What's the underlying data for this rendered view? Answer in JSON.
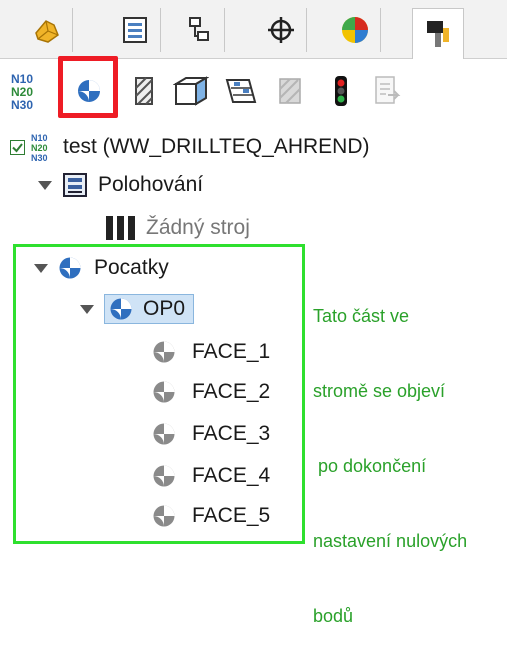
{
  "tabs": [
    {
      "icon": "part-icon"
    },
    {
      "icon": "property-list-icon"
    },
    {
      "icon": "configuration-icon"
    },
    {
      "icon": "crosshair-icon"
    },
    {
      "icon": "appearance-icon"
    },
    {
      "icon": "drillteq-tool-icon"
    }
  ],
  "toolbar": {
    "items": [
      {
        "icon": "nc-program-icon",
        "text": "N10\nN20\nN30"
      },
      {
        "icon": "origin-icon"
      },
      {
        "icon": "hatch-icon"
      },
      {
        "icon": "face-icon"
      },
      {
        "icon": "table-icon"
      },
      {
        "icon": "pattern-icon"
      },
      {
        "icon": "traffic-light-icon"
      },
      {
        "icon": "export-icon"
      }
    ]
  },
  "tree": {
    "root": {
      "label": "test (WW_DRILLTEQ_AHREND)",
      "checked": true
    },
    "positioning": {
      "label": "Polohování"
    },
    "no_machine": {
      "label": "Žádný stroj"
    },
    "origins": {
      "label": "Pocatky"
    },
    "op0": {
      "label": "OP0"
    },
    "faces": [
      {
        "label": "FACE_1"
      },
      {
        "label": "FACE_2"
      },
      {
        "label": "FACE_3"
      },
      {
        "label": "FACE_4"
      },
      {
        "label": "FACE_5"
      }
    ]
  },
  "annotation": {
    "lines": [
      "Tato část ve",
      "stromě se objeví",
      " po dokončení",
      "nastavení nulových",
      "bodů"
    ]
  },
  "colors": {
    "highlight_red": "#ee1c25",
    "highlight_green": "#2ee02e",
    "annotation_text": "#2aa12a",
    "selection": "#cfe3f6"
  }
}
